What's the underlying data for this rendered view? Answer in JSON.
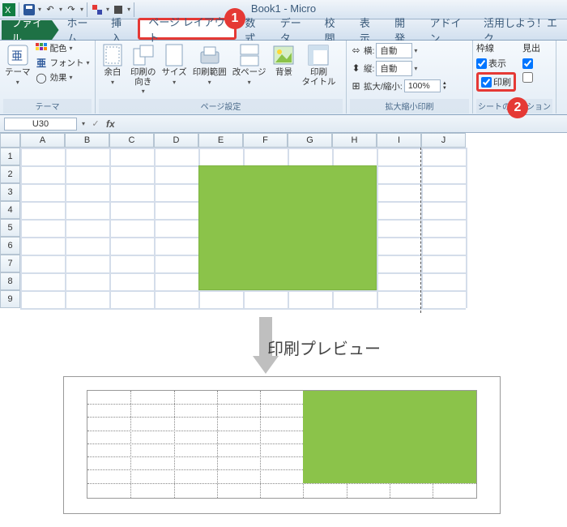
{
  "window_title": "Book1 - Micro",
  "quick_access": [
    "save-icon",
    "undo-icon",
    "redo-icon",
    "paint-icon",
    "shape-icon"
  ],
  "tabs": {
    "file": "ファイル",
    "list": [
      "ホーム",
      "挿入",
      "ページ レイアウト",
      "数式",
      "データ",
      "校閲",
      "表示",
      "開発",
      "アドイン",
      "活用しよう！エク"
    ],
    "highlighted_index": 2
  },
  "ribbon": {
    "theme": {
      "group_label": "テーマ",
      "theme_btn": "テーマ",
      "colors": "配色",
      "fonts": "フォント",
      "effects": "効果"
    },
    "page_setup": {
      "group_label": "ページ設定",
      "margins": "余白",
      "orientation": "印刷の\n向き",
      "size": "サイズ",
      "print_area": "印刷範囲",
      "breaks": "改ページ",
      "background": "背景",
      "print_titles": "印刷\nタイトル"
    },
    "scale": {
      "group_label": "拡大縮小印刷",
      "width_label": "横:",
      "height_label": "縦:",
      "scale_label": "拡大/縮小:",
      "auto": "自動",
      "scale_val": "100%"
    },
    "sheet_options": {
      "group_label": "シートのオプション",
      "gridlines_header": "枠線",
      "headings_header": "見出",
      "view": "表示",
      "print": "印刷",
      "view_chk": true,
      "print_chk": true,
      "head_view_chk": true,
      "head_print_chk": false
    }
  },
  "badges": {
    "one": "1",
    "two": "2"
  },
  "namebox": "U30",
  "fx_label": "fx",
  "grid": {
    "cols": [
      "A",
      "B",
      "C",
      "D",
      "E",
      "F",
      "G",
      "H",
      "I",
      "J"
    ],
    "rows": [
      "1",
      "2",
      "3",
      "4",
      "5",
      "6",
      "7",
      "8",
      "9"
    ],
    "green_range": "E2:H8",
    "page_break_after_col": "I"
  },
  "chart_data": {
    "type": "table",
    "note": "spreadsheet range E2:H8 filled solid green; all other visible cells blank",
    "filled_range": {
      "start": "E2",
      "end": "H8",
      "fill": "#8bc34a"
    }
  },
  "preview": {
    "title": "印刷プレビュー"
  }
}
